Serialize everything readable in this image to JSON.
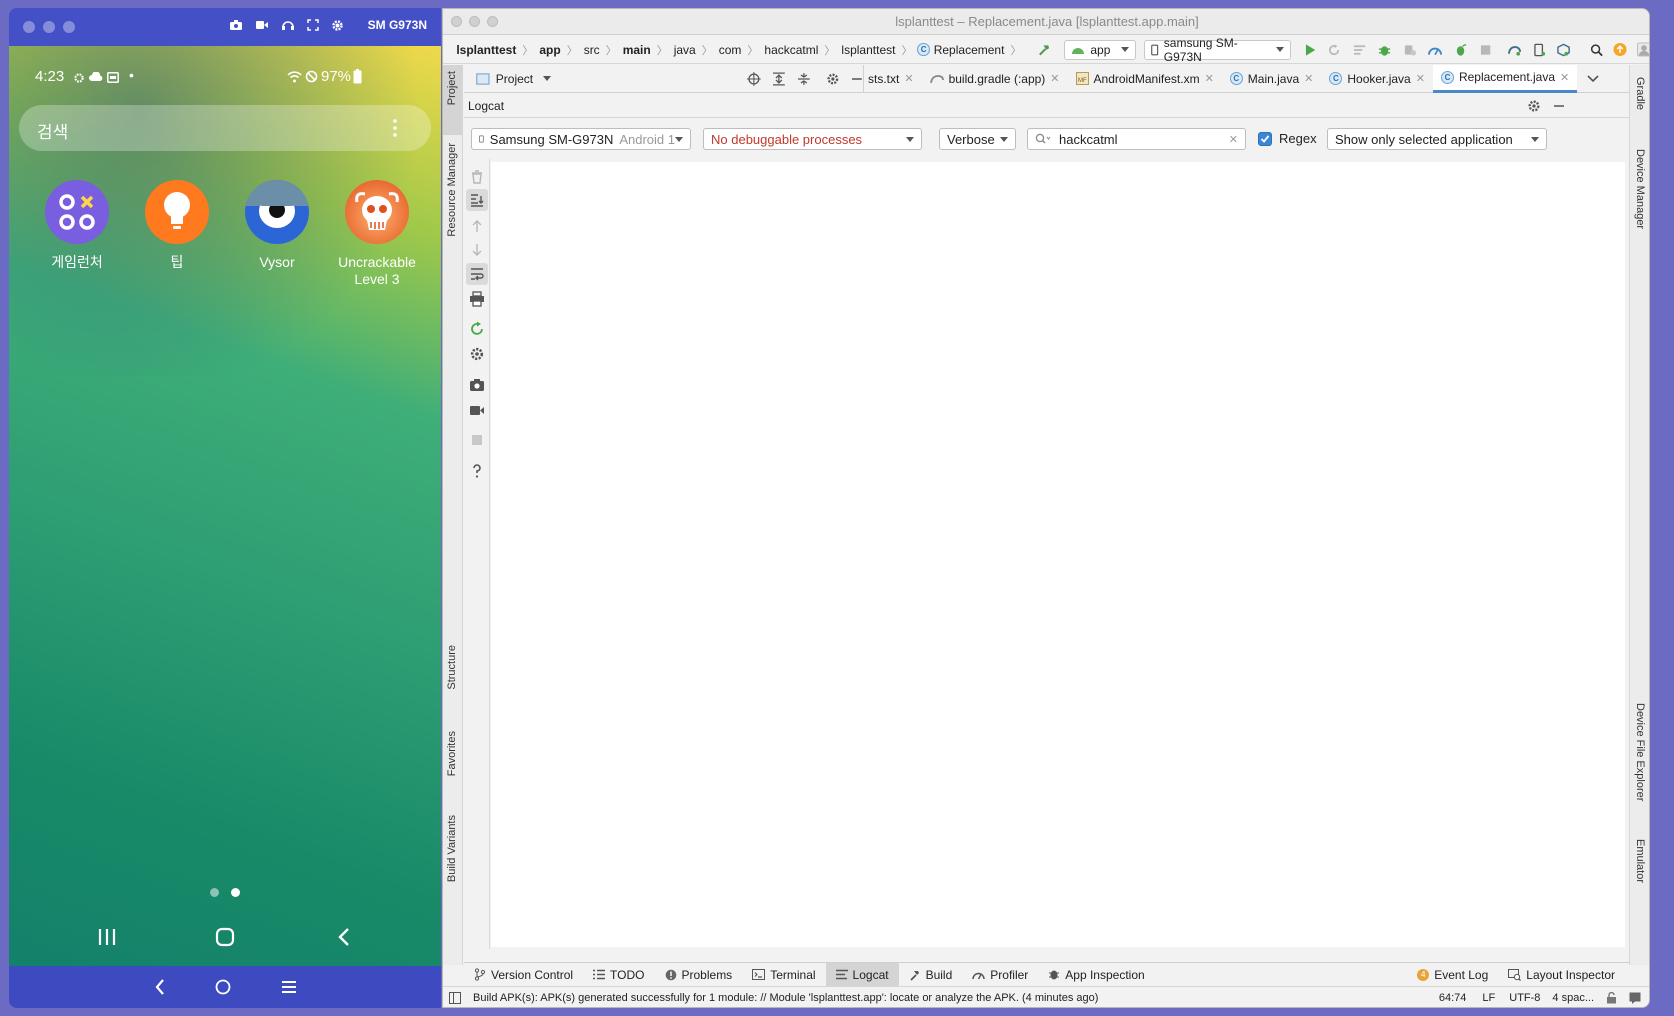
{
  "vysor": {
    "device_title": "SM G973N",
    "status": {
      "time": "4:23",
      "battery": "97%"
    },
    "search_placeholder": "검색",
    "apps": [
      {
        "label": "게임런처"
      },
      {
        "label": "팁"
      },
      {
        "label": "Vysor"
      },
      {
        "label": "Uncrackable Level 3"
      }
    ],
    "page_indicator": {
      "pages": 2,
      "current": 2
    }
  },
  "studio": {
    "window_title": "lsplanttest – Replacement.java [lsplanttest.app.main]",
    "breadcrumbs": [
      "lsplanttest",
      "app",
      "src",
      "main",
      "java",
      "com",
      "hackcatml",
      "lsplanttest",
      "Replacement"
    ],
    "run_config": "app",
    "device_selector": "samsung SM-G973N",
    "project_pane_label": "Project",
    "editor_tabs": [
      {
        "label": "sts.txt",
        "icon": "text-file-icon"
      },
      {
        "label": "build.gradle (:app)",
        "icon": "gradle-icon"
      },
      {
        "label": "AndroidManifest.xm",
        "icon": "manifest-icon"
      },
      {
        "label": "Main.java",
        "icon": "class-icon"
      },
      {
        "label": "Hooker.java",
        "icon": "class-icon"
      },
      {
        "label": "Replacement.java",
        "icon": "class-icon",
        "active": true
      }
    ],
    "left_tool_windows": [
      "Project",
      "Resource Manager",
      "Structure",
      "Favorites",
      "Build Variants"
    ],
    "right_tool_windows": [
      "Gradle",
      "Device Manager",
      "Device File Explorer",
      "Emulator"
    ],
    "logcat": {
      "title": "Logcat",
      "device": "Samsung SM-G973N",
      "device_suffix": "Android 1",
      "process": "No debuggable processes",
      "level": "Verbose",
      "search": "hackcatml",
      "regex_label": "Regex",
      "regex_checked": true,
      "filter": "Show only selected application"
    },
    "bottom_tabs": [
      "Version Control",
      "TODO",
      "Problems",
      "Terminal",
      "Logcat",
      "Build",
      "Profiler",
      "App Inspection"
    ],
    "bottom_right_tabs": [
      {
        "label": "Event Log",
        "badge": "4"
      },
      {
        "label": "Layout Inspector"
      }
    ],
    "status_message": "Build APK(s): APK(s) generated successfully for 1 module: // Module 'lsplanttest.app': locate or analyze the APK. (4 minutes ago)",
    "status_right": {
      "position": "64:74",
      "line_sep": "LF",
      "encoding": "UTF-8",
      "indent": "4 spac..."
    }
  },
  "colors": {
    "vysor_bar": "#4450c6",
    "accent": "#4a88c7",
    "process_error": "#c0392b"
  }
}
